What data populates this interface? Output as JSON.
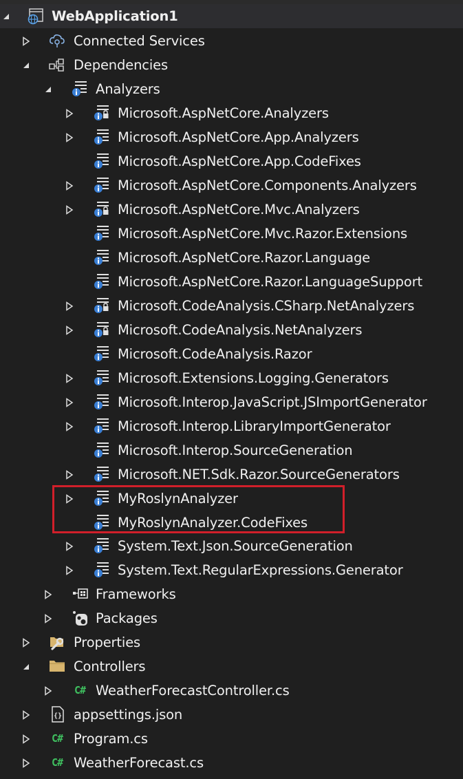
{
  "solution_explorer": {
    "project": {
      "label": "WebApplication1",
      "state": "expanded"
    },
    "items": [
      {
        "label": "Connected Services"
      },
      {
        "label": "Dependencies"
      },
      {
        "label": "Analyzers"
      },
      {
        "label": "Microsoft.AspNetCore.Analyzers"
      },
      {
        "label": "Microsoft.AspNetCore.App.Analyzers"
      },
      {
        "label": "Microsoft.AspNetCore.App.CodeFixes"
      },
      {
        "label": "Microsoft.AspNetCore.Components.Analyzers"
      },
      {
        "label": "Microsoft.AspNetCore.Mvc.Analyzers"
      },
      {
        "label": "Microsoft.AspNetCore.Mvc.Razor.Extensions"
      },
      {
        "label": "Microsoft.AspNetCore.Razor.Language"
      },
      {
        "label": "Microsoft.AspNetCore.Razor.LanguageSupport"
      },
      {
        "label": "Microsoft.CodeAnalysis.CSharp.NetAnalyzers"
      },
      {
        "label": "Microsoft.CodeAnalysis.NetAnalyzers"
      },
      {
        "label": "Microsoft.CodeAnalysis.Razor"
      },
      {
        "label": "Microsoft.Extensions.Logging.Generators"
      },
      {
        "label": "Microsoft.Interop.JavaScript.JSImportGenerator"
      },
      {
        "label": "Microsoft.Interop.LibraryImportGenerator"
      },
      {
        "label": "Microsoft.Interop.SourceGeneration"
      },
      {
        "label": "Microsoft.NET.Sdk.Razor.SourceGenerators"
      },
      {
        "label": "MyRoslynAnalyzer"
      },
      {
        "label": "MyRoslynAnalyzer.CodeFixes"
      },
      {
        "label": "System.Text.Json.SourceGeneration"
      },
      {
        "label": "System.Text.RegularExpressions.Generator"
      },
      {
        "label": "Frameworks"
      },
      {
        "label": "Packages"
      },
      {
        "label": "Properties"
      },
      {
        "label": "Controllers"
      },
      {
        "label": "WeatherForecastController.cs"
      },
      {
        "label": "appsettings.json"
      },
      {
        "label": "Program.cs"
      },
      {
        "label": "WeatherForecast.cs"
      }
    ],
    "csharp_glyph": "C#",
    "json_glyph": "{}",
    "icon_names": {
      "project": "web-project-globe-icon",
      "connected_services": "cloud-plug-icon",
      "dependencies": "dependency-graph-icon",
      "analyzer": "analyzer-icon",
      "analyzer_locked": "analyzer-lock-icon",
      "frameworks": "framework-icon",
      "packages": "package-icon",
      "properties": "properties-wrench-icon",
      "folder": "folder-icon",
      "csharp": "csharp-file-icon",
      "json": "json-file-icon"
    },
    "colors": {
      "background": "#1f1f1f",
      "text": "#f0f0f0",
      "highlight_border": "#d11f2a",
      "info_badge": "#3a7fd5",
      "csharp": "#3fbf5f",
      "folder": "#d8b56e"
    }
  }
}
